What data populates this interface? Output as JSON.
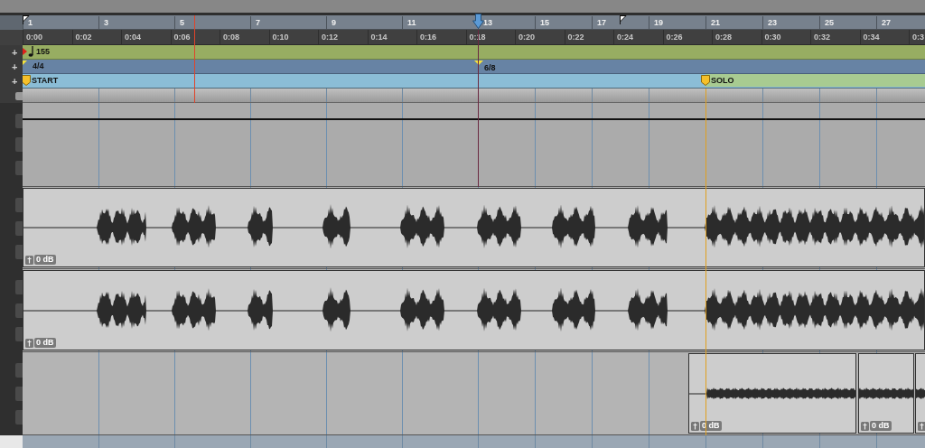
{
  "bar_ruler": {
    "labels": [
      "1",
      "3",
      "5",
      "7",
      "9",
      "11",
      "13",
      "15",
      "17",
      "19",
      "21",
      "23",
      "25",
      "27"
    ]
  },
  "time_ruler": {
    "labels": [
      "0:00",
      "0:02",
      "0:04",
      "0:06",
      "0:08",
      "0:10",
      "0:12",
      "0:14",
      "0:16",
      "0:18",
      "0:20",
      "0:22",
      "0:24",
      "0:26",
      "0:28",
      "0:30",
      "0:32",
      "0:34",
      "0:3"
    ]
  },
  "tempo_ruler": {
    "expand": "+",
    "events": [
      {
        "label": "155"
      }
    ]
  },
  "meter_ruler": {
    "expand": "+",
    "events": [
      {
        "label": "4/4"
      },
      {
        "label": "6/8"
      }
    ]
  },
  "marker_ruler": {
    "expand": "+",
    "markers": [
      {
        "label": "START",
        "color": "#8bbdd6"
      },
      {
        "label": "SOLO",
        "color": "#a8cb91"
      }
    ]
  },
  "tracks": [
    {
      "kind": "automation"
    },
    {
      "kind": "audio",
      "clips": [
        {
          "gain_icon": true,
          "gain": "0 dB"
        }
      ]
    },
    {
      "kind": "audio",
      "clips": [
        {
          "gain_icon": true,
          "gain": "0 dB"
        }
      ]
    },
    {
      "kind": "audio",
      "clips": [
        {
          "gain_icon": true,
          "gain": "0 dB"
        },
        {
          "gain_icon": true,
          "gain": "0 dB"
        },
        {
          "gain_icon": true
        }
      ]
    }
  ]
}
